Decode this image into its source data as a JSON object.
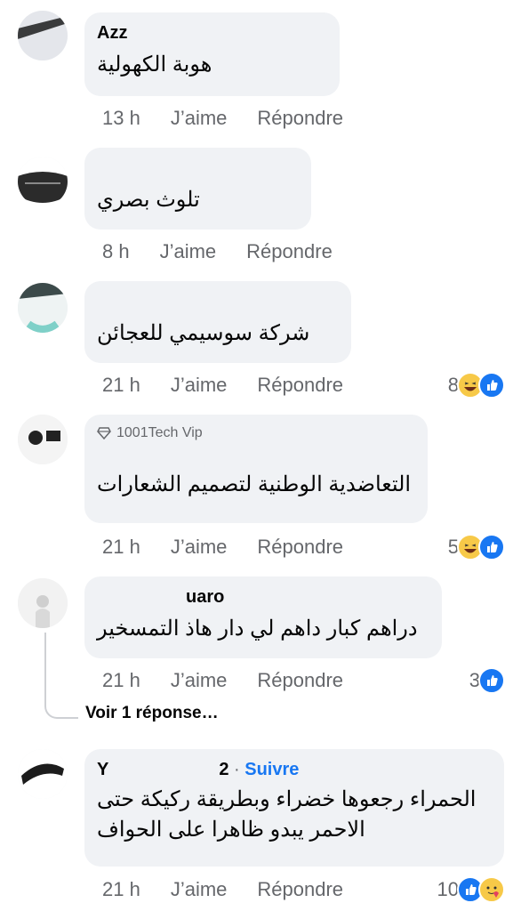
{
  "colors": {
    "bubble": "#f0f2f5",
    "meta": "#65676b",
    "link": "#1877f2",
    "text": "#050505"
  },
  "comments": [
    {
      "author": "Azz",
      "text": "هوبة الكهولية",
      "time": "13 h",
      "like": "J’aime",
      "reply": "Répondre",
      "reaction_count": "",
      "reactions": []
    },
    {
      "author": "",
      "text": "تلوث بصري",
      "time": "8 h",
      "like": "J’aime",
      "reply": "Répondre",
      "reaction_count": "",
      "reactions": []
    },
    {
      "author": "",
      "text": "شركة سوسيمي للعجائن",
      "time": "21 h",
      "like": "J’aime",
      "reply": "Répondre",
      "reaction_count": "8",
      "reactions": [
        "haha-icon",
        "like-icon"
      ]
    },
    {
      "badge": "1001Tech Vip",
      "author": "",
      "text": "التعاضدية الوطنية لتصميم الشعارات",
      "time": "21 h",
      "like": "J’aime",
      "reply": "Répondre",
      "reaction_count": "5",
      "reactions": [
        "haha-icon",
        "like-icon"
      ]
    },
    {
      "author": "uaro",
      "text": "دراهم كبار داهم لي دار هاذ التمسخير",
      "time": "21 h",
      "like": "J’aime",
      "reply": "Répondre",
      "reaction_count": "3",
      "reactions": [
        "like-icon"
      ]
    },
    {
      "author": "Y",
      "author_suffix": "2",
      "follow": "Suivre",
      "text_line1": "الحمراء رجعوها خضراء وبطريقة ركيكة حتى",
      "text_line2": "الاحمر يبدو ظاهرا على الحواف",
      "time": "21 h",
      "like": "J’aime",
      "reply": "Répondre",
      "reaction_count": "10",
      "reactions": [
        "like-icon",
        "care-icon"
      ]
    }
  ],
  "voir_reponse": "Voir 1 réponse…",
  "separator": " · "
}
